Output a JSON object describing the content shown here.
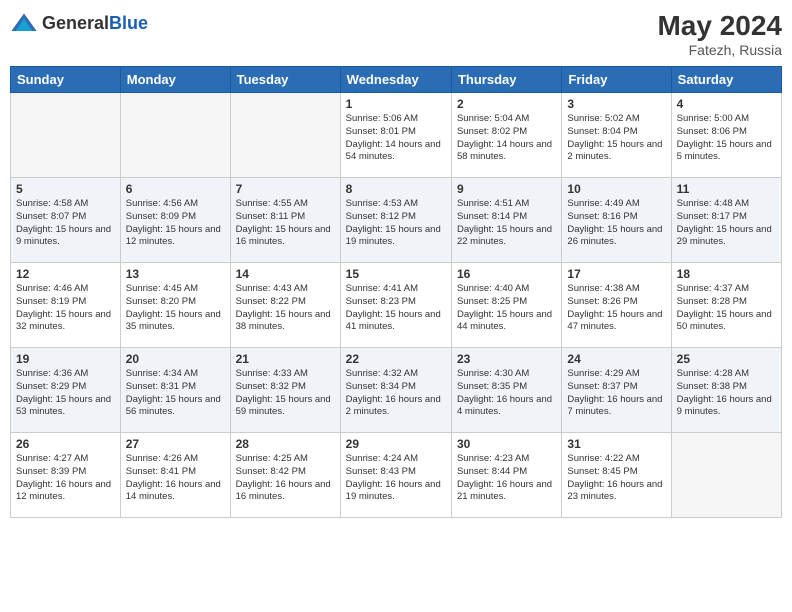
{
  "header": {
    "logo_line1": "General",
    "logo_line2": "Blue",
    "month_year": "May 2024",
    "location": "Fatezh, Russia"
  },
  "weekdays": [
    "Sunday",
    "Monday",
    "Tuesday",
    "Wednesday",
    "Thursday",
    "Friday",
    "Saturday"
  ],
  "weeks": [
    [
      {
        "day": "",
        "sunrise": "",
        "sunset": "",
        "daylight": ""
      },
      {
        "day": "",
        "sunrise": "",
        "sunset": "",
        "daylight": ""
      },
      {
        "day": "",
        "sunrise": "",
        "sunset": "",
        "daylight": ""
      },
      {
        "day": "1",
        "sunrise": "Sunrise: 5:06 AM",
        "sunset": "Sunset: 8:01 PM",
        "daylight": "Daylight: 14 hours and 54 minutes."
      },
      {
        "day": "2",
        "sunrise": "Sunrise: 5:04 AM",
        "sunset": "Sunset: 8:02 PM",
        "daylight": "Daylight: 14 hours and 58 minutes."
      },
      {
        "day": "3",
        "sunrise": "Sunrise: 5:02 AM",
        "sunset": "Sunset: 8:04 PM",
        "daylight": "Daylight: 15 hours and 2 minutes."
      },
      {
        "day": "4",
        "sunrise": "Sunrise: 5:00 AM",
        "sunset": "Sunset: 8:06 PM",
        "daylight": "Daylight: 15 hours and 5 minutes."
      }
    ],
    [
      {
        "day": "5",
        "sunrise": "Sunrise: 4:58 AM",
        "sunset": "Sunset: 8:07 PM",
        "daylight": "Daylight: 15 hours and 9 minutes."
      },
      {
        "day": "6",
        "sunrise": "Sunrise: 4:56 AM",
        "sunset": "Sunset: 8:09 PM",
        "daylight": "Daylight: 15 hours and 12 minutes."
      },
      {
        "day": "7",
        "sunrise": "Sunrise: 4:55 AM",
        "sunset": "Sunset: 8:11 PM",
        "daylight": "Daylight: 15 hours and 16 minutes."
      },
      {
        "day": "8",
        "sunrise": "Sunrise: 4:53 AM",
        "sunset": "Sunset: 8:12 PM",
        "daylight": "Daylight: 15 hours and 19 minutes."
      },
      {
        "day": "9",
        "sunrise": "Sunrise: 4:51 AM",
        "sunset": "Sunset: 8:14 PM",
        "daylight": "Daylight: 15 hours and 22 minutes."
      },
      {
        "day": "10",
        "sunrise": "Sunrise: 4:49 AM",
        "sunset": "Sunset: 8:16 PM",
        "daylight": "Daylight: 15 hours and 26 minutes."
      },
      {
        "day": "11",
        "sunrise": "Sunrise: 4:48 AM",
        "sunset": "Sunset: 8:17 PM",
        "daylight": "Daylight: 15 hours and 29 minutes."
      }
    ],
    [
      {
        "day": "12",
        "sunrise": "Sunrise: 4:46 AM",
        "sunset": "Sunset: 8:19 PM",
        "daylight": "Daylight: 15 hours and 32 minutes."
      },
      {
        "day": "13",
        "sunrise": "Sunrise: 4:45 AM",
        "sunset": "Sunset: 8:20 PM",
        "daylight": "Daylight: 15 hours and 35 minutes."
      },
      {
        "day": "14",
        "sunrise": "Sunrise: 4:43 AM",
        "sunset": "Sunset: 8:22 PM",
        "daylight": "Daylight: 15 hours and 38 minutes."
      },
      {
        "day": "15",
        "sunrise": "Sunrise: 4:41 AM",
        "sunset": "Sunset: 8:23 PM",
        "daylight": "Daylight: 15 hours and 41 minutes."
      },
      {
        "day": "16",
        "sunrise": "Sunrise: 4:40 AM",
        "sunset": "Sunset: 8:25 PM",
        "daylight": "Daylight: 15 hours and 44 minutes."
      },
      {
        "day": "17",
        "sunrise": "Sunrise: 4:38 AM",
        "sunset": "Sunset: 8:26 PM",
        "daylight": "Daylight: 15 hours and 47 minutes."
      },
      {
        "day": "18",
        "sunrise": "Sunrise: 4:37 AM",
        "sunset": "Sunset: 8:28 PM",
        "daylight": "Daylight: 15 hours and 50 minutes."
      }
    ],
    [
      {
        "day": "19",
        "sunrise": "Sunrise: 4:36 AM",
        "sunset": "Sunset: 8:29 PM",
        "daylight": "Daylight: 15 hours and 53 minutes."
      },
      {
        "day": "20",
        "sunrise": "Sunrise: 4:34 AM",
        "sunset": "Sunset: 8:31 PM",
        "daylight": "Daylight: 15 hours and 56 minutes."
      },
      {
        "day": "21",
        "sunrise": "Sunrise: 4:33 AM",
        "sunset": "Sunset: 8:32 PM",
        "daylight": "Daylight: 15 hours and 59 minutes."
      },
      {
        "day": "22",
        "sunrise": "Sunrise: 4:32 AM",
        "sunset": "Sunset: 8:34 PM",
        "daylight": "Daylight: 16 hours and 2 minutes."
      },
      {
        "day": "23",
        "sunrise": "Sunrise: 4:30 AM",
        "sunset": "Sunset: 8:35 PM",
        "daylight": "Daylight: 16 hours and 4 minutes."
      },
      {
        "day": "24",
        "sunrise": "Sunrise: 4:29 AM",
        "sunset": "Sunset: 8:37 PM",
        "daylight": "Daylight: 16 hours and 7 minutes."
      },
      {
        "day": "25",
        "sunrise": "Sunrise: 4:28 AM",
        "sunset": "Sunset: 8:38 PM",
        "daylight": "Daylight: 16 hours and 9 minutes."
      }
    ],
    [
      {
        "day": "26",
        "sunrise": "Sunrise: 4:27 AM",
        "sunset": "Sunset: 8:39 PM",
        "daylight": "Daylight: 16 hours and 12 minutes."
      },
      {
        "day": "27",
        "sunrise": "Sunrise: 4:26 AM",
        "sunset": "Sunset: 8:41 PM",
        "daylight": "Daylight: 16 hours and 14 minutes."
      },
      {
        "day": "28",
        "sunrise": "Sunrise: 4:25 AM",
        "sunset": "Sunset: 8:42 PM",
        "daylight": "Daylight: 16 hours and 16 minutes."
      },
      {
        "day": "29",
        "sunrise": "Sunrise: 4:24 AM",
        "sunset": "Sunset: 8:43 PM",
        "daylight": "Daylight: 16 hours and 19 minutes."
      },
      {
        "day": "30",
        "sunrise": "Sunrise: 4:23 AM",
        "sunset": "Sunset: 8:44 PM",
        "daylight": "Daylight: 16 hours and 21 minutes."
      },
      {
        "day": "31",
        "sunrise": "Sunrise: 4:22 AM",
        "sunset": "Sunset: 8:45 PM",
        "daylight": "Daylight: 16 hours and 23 minutes."
      },
      {
        "day": "",
        "sunrise": "",
        "sunset": "",
        "daylight": ""
      }
    ]
  ]
}
